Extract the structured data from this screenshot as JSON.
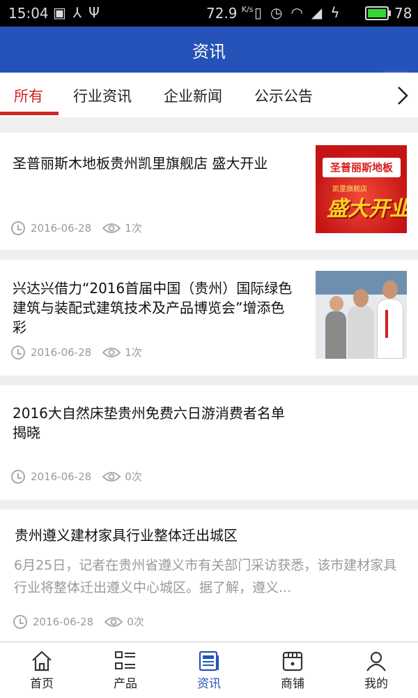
{
  "status_bar": {
    "time": "15:04",
    "speed": "72.9",
    "speed_unit": "K/s",
    "battery": "78"
  },
  "header": {
    "title": "资讯"
  },
  "tabs": [
    {
      "label": "所有",
      "active": true
    },
    {
      "label": "行业资讯"
    },
    {
      "label": "企业新闻"
    },
    {
      "label": "公示公告"
    }
  ],
  "articles": [
    {
      "title": "圣普丽斯木地板贵州凯里旗舰店 盛大开业",
      "date": "2016-06-28",
      "views": "1次",
      "thumb": {
        "line1": "圣普丽斯地板",
        "line2": "凯里旗舰店",
        "line3": "盛大开业"
      }
    },
    {
      "title": "兴达兴借力“2016首届中国（贵州）国际绿色建筑与装配式建筑技术及产品博览会”增添色彩",
      "date": "2016-06-28",
      "views": "1次"
    },
    {
      "title": "2016大自然床垫贵州免费六日游消费者名单揭晓",
      "date": "2016-06-28",
      "views": "0次"
    },
    {
      "title": "贵州遵义建材家具行业整体迁出城区",
      "excerpt": "6月25日，记者在贵州省遵义市有关部门采访获悉，该市建材家具行业将整体迁出遵义中心城区。据了解，遵义...",
      "date": "2016-06-28",
      "views": "0次"
    }
  ],
  "bottom_nav": [
    {
      "label": "首页",
      "icon": "home-icon"
    },
    {
      "label": "产品",
      "icon": "product-list-icon"
    },
    {
      "label": "资讯",
      "icon": "news-icon",
      "active": true
    },
    {
      "label": "商铺",
      "icon": "shop-icon"
    },
    {
      "label": "我的",
      "icon": "user-icon"
    }
  ],
  "colors": {
    "primary": "#2552b8",
    "accent": "#d32323",
    "muted": "#9a9a9a"
  }
}
